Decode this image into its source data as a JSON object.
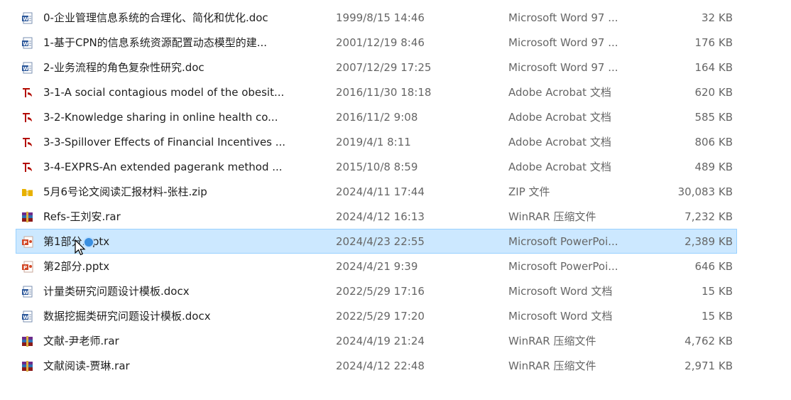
{
  "files": [
    {
      "name": "0-企业管理信息系统的合理化、简化和优化.doc",
      "modified": "1999/8/15 14:46",
      "type": "Microsoft Word 97 ...",
      "size": "32 KB",
      "icon": "word-doc-icon",
      "selected": false
    },
    {
      "name": "1-基于CPN的信息系统资源配置动态模型的建...",
      "modified": "2001/12/19 8:46",
      "type": "Microsoft Word 97 ...",
      "size": "176 KB",
      "icon": "word-doc-icon",
      "selected": false
    },
    {
      "name": "2-业务流程的角色复杂性研究.doc",
      "modified": "2007/12/29 17:25",
      "type": "Microsoft Word 97 ...",
      "size": "164 KB",
      "icon": "word-doc-icon",
      "selected": false
    },
    {
      "name": "3-1-A social contagious model of the obesit...",
      "modified": "2016/11/30 18:18",
      "type": "Adobe Acrobat 文档",
      "size": "620 KB",
      "icon": "pdf-icon",
      "selected": false
    },
    {
      "name": "3-2-Knowledge sharing in online health co...",
      "modified": "2016/11/2 9:08",
      "type": "Adobe Acrobat 文档",
      "size": "585 KB",
      "icon": "pdf-icon",
      "selected": false
    },
    {
      "name": "3-3-Spillover Effects of Financial Incentives ...",
      "modified": "2019/4/1 8:11",
      "type": "Adobe Acrobat 文档",
      "size": "806 KB",
      "icon": "pdf-icon",
      "selected": false
    },
    {
      "name": "3-4-EXPRS-An extended pagerank method ...",
      "modified": "2015/10/8 8:59",
      "type": "Adobe Acrobat 文档",
      "size": "489 KB",
      "icon": "pdf-icon",
      "selected": false
    },
    {
      "name": "5月6号论文阅读汇报材料-张柱.zip",
      "modified": "2024/4/11 17:44",
      "type": "ZIP 文件",
      "size": "30,083 KB",
      "icon": "zip-icon",
      "selected": false
    },
    {
      "name": "Refs-王刘安.rar",
      "modified": "2024/4/12 16:13",
      "type": "WinRAR 压缩文件",
      "size": "7,232 KB",
      "icon": "rar-icon",
      "selected": false
    },
    {
      "name": "第1部分.pptx",
      "modified": "2024/4/23 22:55",
      "type": "Microsoft PowerPoi...",
      "size": "2,389 KB",
      "icon": "pptx-icon",
      "selected": true
    },
    {
      "name": "第2部分.pptx",
      "modified": "2024/4/21 9:39",
      "type": "Microsoft PowerPoi...",
      "size": "646 KB",
      "icon": "pptx-icon",
      "selected": false
    },
    {
      "name": "计量类研究问题设计模板.docx",
      "modified": "2022/5/29 17:16",
      "type": "Microsoft Word 文档",
      "size": "15 KB",
      "icon": "word-docx-icon",
      "selected": false
    },
    {
      "name": "数据挖掘类研究问题设计模板.docx",
      "modified": "2022/5/29 17:20",
      "type": "Microsoft Word 文档",
      "size": "15 KB",
      "icon": "word-docx-icon",
      "selected": false
    },
    {
      "name": "文献-尹老师.rar",
      "modified": "2024/4/19 21:24",
      "type": "WinRAR 压缩文件",
      "size": "4,762 KB",
      "icon": "rar-icon",
      "selected": false
    },
    {
      "name": "文献阅读-贾琳.rar",
      "modified": "2024/4/12 22:48",
      "type": "WinRAR 压缩文件",
      "size": "2,971 KB",
      "icon": "rar-icon",
      "selected": false
    }
  ],
  "colors": {
    "selection_bg": "#cce8ff",
    "selection_border": "#99d1ff",
    "word": "#2b579a",
    "pdf": "#b30b00",
    "pptx": "#d24726",
    "zip": "#e8b100",
    "rar": "#8b1a1a"
  }
}
